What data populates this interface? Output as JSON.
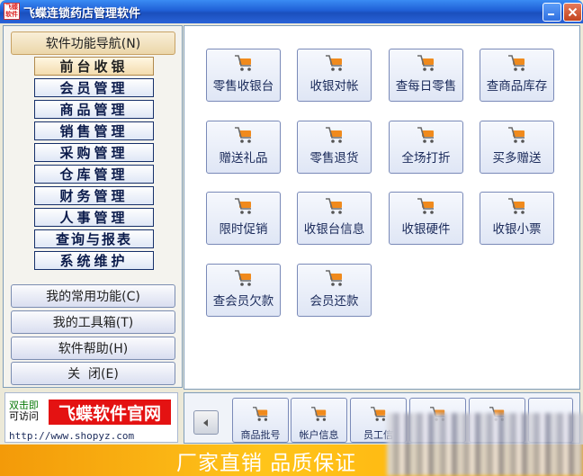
{
  "window": {
    "title": "飞蝶连锁药店管理软件",
    "icon_text": "飞蝶软件"
  },
  "nav": {
    "header": "软件功能导航(N)",
    "items": [
      {
        "label": "前台收银",
        "active": true
      },
      {
        "label": "会员管理"
      },
      {
        "label": "商品管理"
      },
      {
        "label": "销售管理"
      },
      {
        "label": "采购管理"
      },
      {
        "label": "仓库管理"
      },
      {
        "label": "财务管理"
      },
      {
        "label": "人事管理"
      },
      {
        "label": "查询与报表"
      },
      {
        "label": "系统维护"
      }
    ],
    "sections": [
      {
        "label": "我的常用功能(C)"
      },
      {
        "label": "我的工具箱(T)"
      },
      {
        "label": "软件帮助(H)"
      },
      {
        "label": "关  闭(E)"
      }
    ]
  },
  "functions": [
    {
      "label": "零售收银台",
      "icon": "cart-icon"
    },
    {
      "label": "收银对帐",
      "icon": "cart-icon"
    },
    {
      "label": "查每日零售",
      "icon": "cart-icon"
    },
    {
      "label": "查商品库存",
      "icon": "cart-icon"
    },
    {
      "label": "赠送礼品",
      "icon": "cart-icon"
    },
    {
      "label": "零售退货",
      "icon": "cart-icon"
    },
    {
      "label": "全场打折",
      "icon": "cart-icon"
    },
    {
      "label": "买多赠送",
      "icon": "cart-icon"
    },
    {
      "label": "限时促销",
      "icon": "cart-icon"
    },
    {
      "label": "收银台信息",
      "icon": "cart-icon"
    },
    {
      "label": "收银硬件",
      "icon": "cart-icon"
    },
    {
      "label": "收银小票",
      "icon": "cart-icon"
    },
    {
      "label": "查会员欠款",
      "icon": "cart-icon"
    },
    {
      "label": "会员还款",
      "icon": "cart-icon"
    }
  ],
  "logo": {
    "line1": "双击即",
    "line2": "可访问",
    "brand": "飞蝶软件官网",
    "url": "http://www.shopyz.com"
  },
  "toolbar": {
    "items": [
      {
        "label": "商品批号"
      },
      {
        "label": "帐户信息"
      },
      {
        "label": "员工信"
      }
    ]
  },
  "banner": {
    "text": "厂家直销 品质保证"
  },
  "colors": {
    "titlebar": "#1f5fd6",
    "cart": "#f08a1c",
    "accent": "#e41212",
    "banner": "#ffb20f"
  }
}
